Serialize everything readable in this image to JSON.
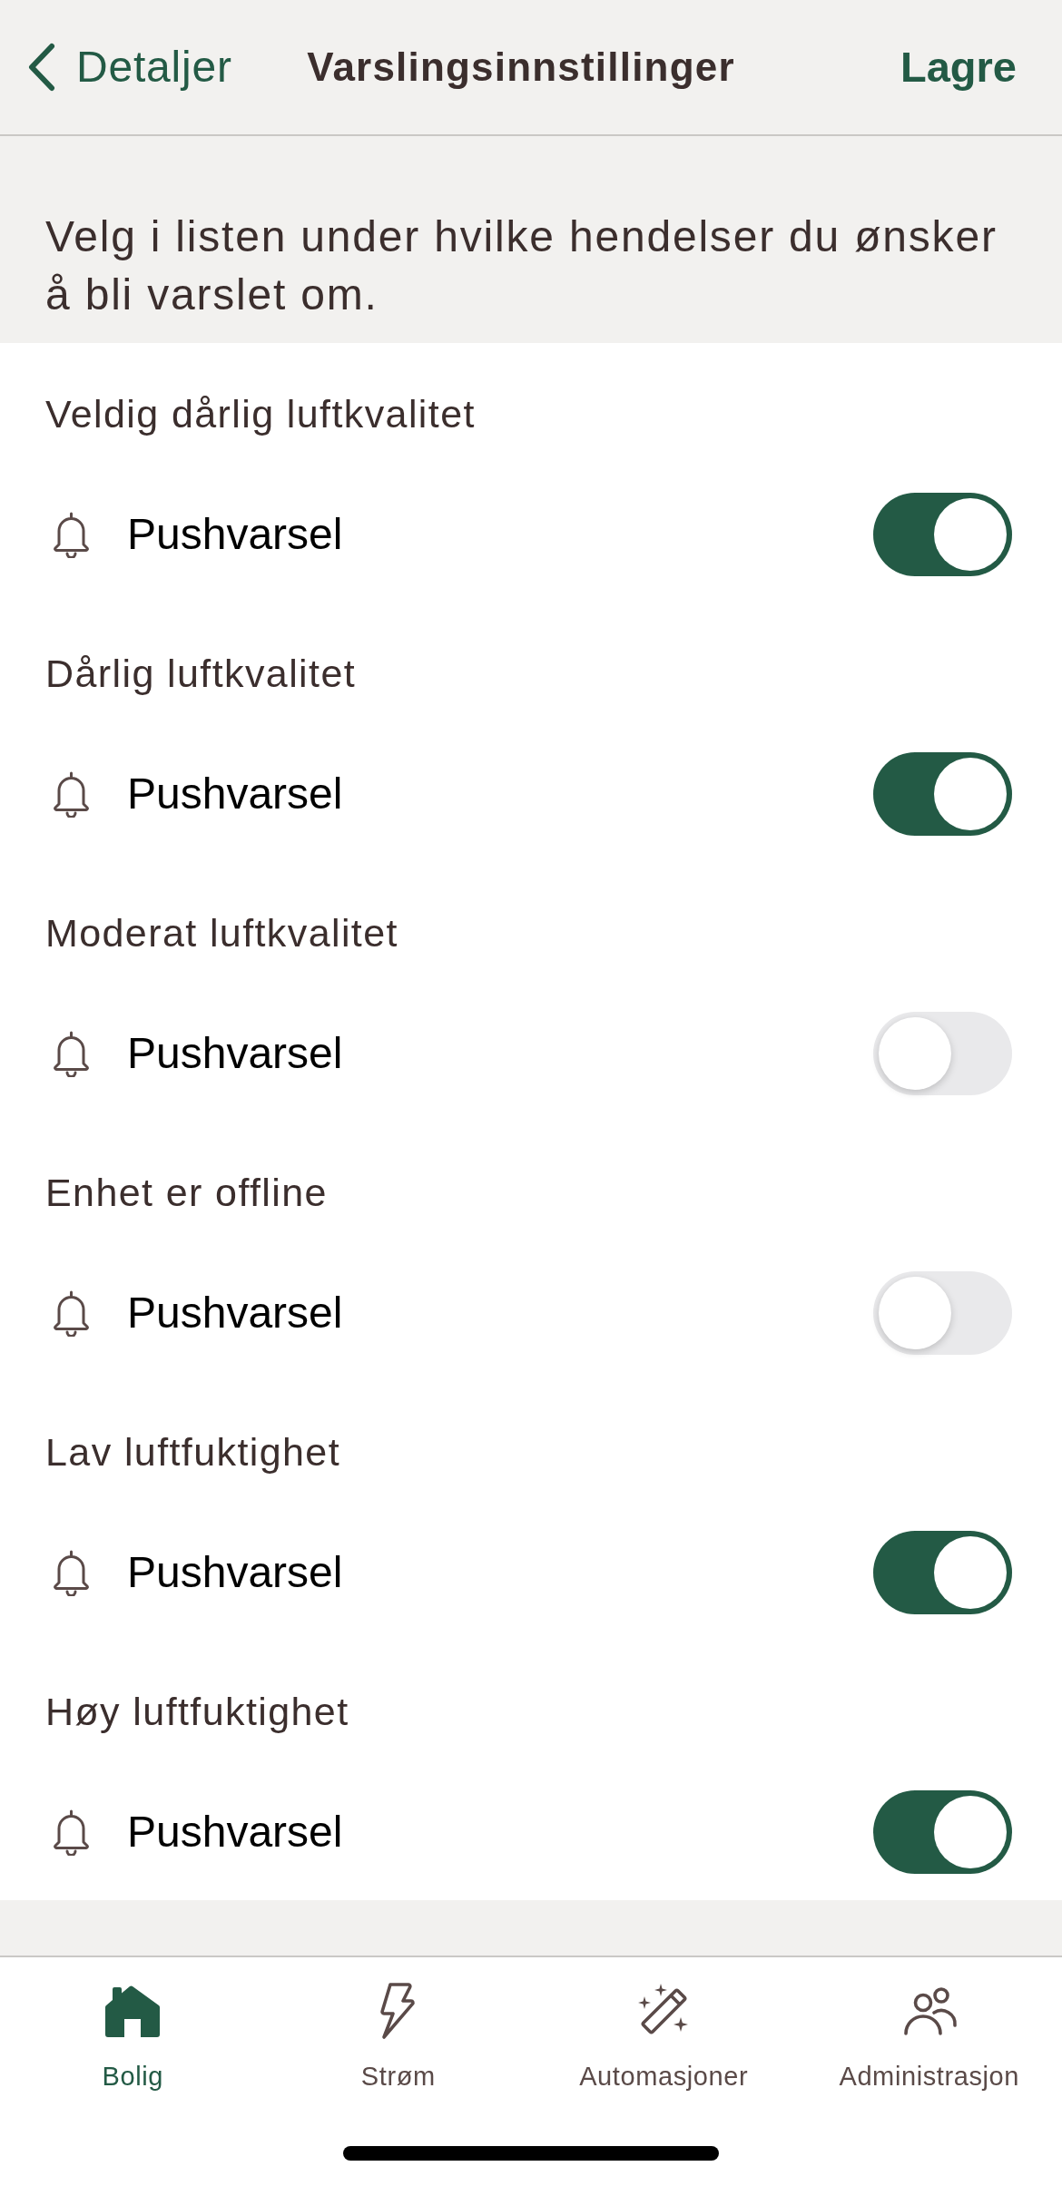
{
  "header": {
    "back_label": "Detaljer",
    "title": "Varslingsinnstillinger",
    "action": "Lagre"
  },
  "intro": "Velg i listen under hvilke hendelser du ønsker å bli varslet om.",
  "sections": [
    {
      "heading": "Veldig dårlig luftkvalitet",
      "setting": {
        "label": "Pushvarsel",
        "on": true
      }
    },
    {
      "heading": "Dårlig luftkvalitet",
      "setting": {
        "label": "Pushvarsel",
        "on": true
      }
    },
    {
      "heading": "Moderat luftkvalitet",
      "setting": {
        "label": "Pushvarsel",
        "on": false
      }
    },
    {
      "heading": "Enhet er offline",
      "setting": {
        "label": "Pushvarsel",
        "on": false
      }
    },
    {
      "heading": "Lav luftfuktighet",
      "setting": {
        "label": "Pushvarsel",
        "on": true
      }
    },
    {
      "heading": "Høy luftfuktighet",
      "setting": {
        "label": "Pushvarsel",
        "on": true
      }
    }
  ],
  "tab_bar": [
    {
      "label": "Bolig",
      "kind": "home",
      "selected": true
    },
    {
      "label": "Strøm",
      "kind": "bolt",
      "selected": false
    },
    {
      "label": "Automasjoner",
      "kind": "wand",
      "selected": false
    },
    {
      "label": "Administrasjon",
      "kind": "people",
      "selected": false
    }
  ]
}
